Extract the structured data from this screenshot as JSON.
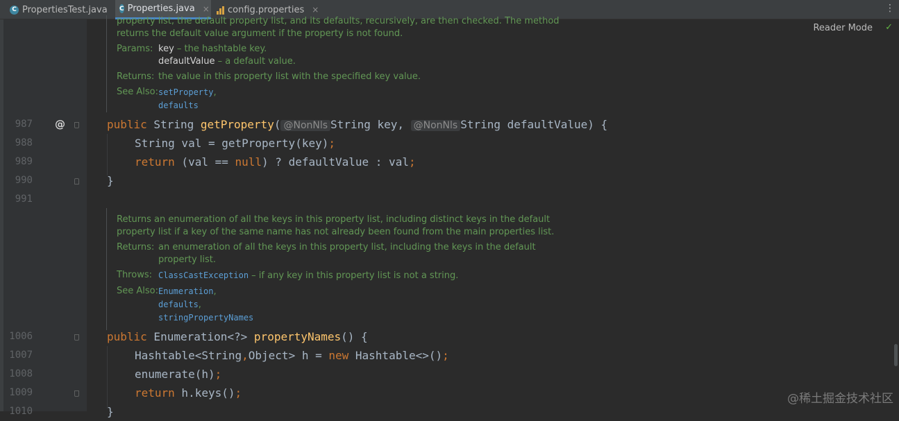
{
  "tabs": [
    {
      "label": "PropertiesTest.java",
      "icon": "class-icon",
      "active": false
    },
    {
      "label": "Properties.java",
      "icon": "class-icon",
      "active": true
    },
    {
      "label": "config.properties",
      "icon": "properties-file-icon",
      "active": false
    }
  ],
  "icons": {
    "tab_close": "×",
    "more": "⋮",
    "check": "✓",
    "override": "@",
    "class_letter": "C"
  },
  "reader_mode_label": "Reader Mode",
  "doc1": {
    "line1": "property list, the default property list, and its defaults, recursively, are then checked. The method",
    "line2": "returns the default value argument if the property is not found.",
    "params_label": "Params:",
    "param1_name": "key",
    "param1_desc": " – the hashtable key.",
    "param2_name": "defaultValue",
    "param2_desc": " – a default value.",
    "returns_label": "Returns:",
    "returns_text": "the value in this property list with the specified key value.",
    "see_label": "See Also:",
    "see1": "setProperty",
    "see1_sep": ",",
    "see2": "defaults"
  },
  "doc2": {
    "line1": "Returns an enumeration of all the keys in this property list, including distinct keys in the default",
    "line2": "property list if a key of the same name has not already been found from the main properties list.",
    "returns_label": "Returns:",
    "returns_line1": "an enumeration of all the keys in this property list, including the keys in the default",
    "returns_line2": "property list.",
    "throws_label": "Throws:",
    "throws_link": "ClassCastException",
    "throws_desc": " – if any key in this property list is not a string.",
    "see_label": "See Also:",
    "see1": "Enumeration",
    "see1_sep": ",",
    "see2": "defaults",
    "see2_sep": ",",
    "see3": "stringPropertyNames"
  },
  "lines": {
    "n987": "987",
    "n988": "988",
    "n989": "989",
    "n990": "990",
    "n991": "991",
    "n1006": "1006",
    "n1007": "1007",
    "n1008": "1008",
    "n1009": "1009",
    "n1010": "1010"
  },
  "code": {
    "l987": {
      "kw1": "public",
      "t1": " String ",
      "fn": "getProperty",
      "p1": "(",
      "ann1": "@NonNls",
      "t2": "String key, ",
      "ann2": "@NonNls",
      "t3": "String defaultValue) {"
    },
    "l988": {
      "t": "String val = getProperty(key)",
      "semi": ";"
    },
    "l989": {
      "kw": "return",
      "t1": " (val == ",
      "kw2": "null",
      "t2": ") ? defaultValue : val",
      "semi": ";"
    },
    "l990": {
      "t": "}"
    },
    "l1006": {
      "kw": "public",
      "t1": " Enumeration<?> ",
      "fn": "propertyNames",
      "t2": "() {"
    },
    "l1007": {
      "t1": "Hashtable<String",
      "c": ",",
      "t2": "Object> h = ",
      "kw": "new",
      "t3": " Hashtable<>()",
      "semi": ";"
    },
    "l1008": {
      "t": "enumerate(h)",
      "semi": ";"
    },
    "l1009": {
      "kw": "return",
      "t": " h.keys()",
      "semi": ";"
    },
    "l1010": {
      "t": "}"
    }
  },
  "watermark": "@稀土掘金技术社区",
  "colors": {
    "background": "#2b2b2b",
    "keyword": "#cc7832",
    "method": "#ffc66d",
    "doc": "#629755",
    "link": "#5c9fd6"
  }
}
